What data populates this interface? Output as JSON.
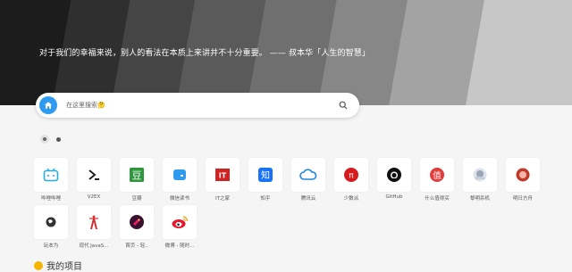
{
  "hero": {
    "quote": "对于我们的幸福来说，别人的看法在本质上来讲并不十分重要。 —— 叔本华「人生的智慧」"
  },
  "search": {
    "placeholder": "在这里搜索🤔",
    "engine_icon": "home-icon",
    "button_icon": "search-icon"
  },
  "pager": {
    "pages": 2,
    "active": 1
  },
  "sites": [
    {
      "label": "哔哩哔哩",
      "icon": "bilibili-icon",
      "color": "#23ade5"
    },
    {
      "label": "V2EX",
      "icon": "v2ex-icon",
      "color": "#222222"
    },
    {
      "label": "豆瓣",
      "icon": "douban-icon",
      "color": "#2e963d"
    },
    {
      "label": "微信读书",
      "icon": "weread-icon",
      "color": "#2f9bf0"
    },
    {
      "label": "IT之家",
      "icon": "ithome-icon",
      "color": "#d22222"
    },
    {
      "label": "知乎",
      "icon": "zhihu-icon",
      "color": "#1772f6"
    },
    {
      "label": "腾讯云",
      "icon": "tencent-cloud-icon",
      "color": "#1e88e5"
    },
    {
      "label": "少数派",
      "icon": "sspai-icon",
      "color": "#d71a1b"
    },
    {
      "label": "GitHub",
      "icon": "github-icon",
      "color": "#111111"
    },
    {
      "label": "什么值得买",
      "icon": "smzdm-icon",
      "color": "#e23c3c"
    },
    {
      "label": "黎明杀机",
      "icon": "game-icon",
      "color": "#9aa6b8"
    },
    {
      "label": "明日方舟",
      "icon": "anime-icon",
      "color": "#c0392b"
    },
    {
      "label": "玩本为",
      "icon": "globe-icon",
      "color": "#333333"
    },
    {
      "label": "现代 JavaS...",
      "icon": "js-tower-icon",
      "color": "#d32f2f"
    },
    {
      "label": "首页 - 轻..",
      "icon": "rocket-icon",
      "color": "#b71c5c"
    },
    {
      "label": "微博 - 随时...",
      "icon": "weibo-icon",
      "color": "#e6162d"
    }
  ],
  "section": {
    "title": "我的项目",
    "icon": "smile-icon"
  }
}
